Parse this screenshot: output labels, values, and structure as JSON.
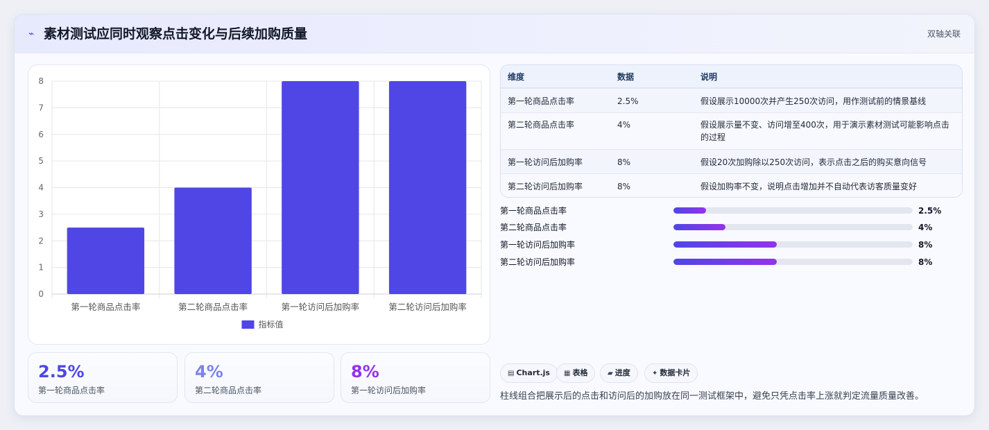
{
  "header": {
    "icon": "lightning-icon",
    "title": "素材测试应同时观察点击变化与后续加购质量",
    "badge": "双轴关联"
  },
  "chart_data": {
    "type": "bar",
    "categories": [
      "第一轮商品点击率",
      "第二轮商品点击率",
      "第一轮访问后加购率",
      "第二轮访问后加购率"
    ],
    "series": [
      {
        "name": "指标值",
        "values": [
          2.5,
          4,
          8,
          8
        ],
        "color": "#4f46e5"
      }
    ],
    "ylim": [
      0,
      8
    ],
    "yticks": [
      0,
      1,
      2,
      3,
      4,
      5,
      6,
      7,
      8
    ],
    "grid": true,
    "legend": "bottom"
  },
  "kpis": [
    {
      "value": "2.5%",
      "label": "第一轮商品点击率",
      "color": "#4f46e5"
    },
    {
      "value": "4%",
      "label": "第二轮商品点击率",
      "color": "#7c83ec"
    },
    {
      "value": "8%",
      "label": "第一轮访问后加购率",
      "color": "#9333ea"
    }
  ],
  "table": {
    "headers": [
      "维度",
      "数据",
      "说明"
    ],
    "rows": [
      {
        "dim": "第一轮商品点击率",
        "value": "2.5%",
        "desc": "假设展示10000次并产生250次访问，用作测试前的情景基线"
      },
      {
        "dim": "第二轮商品点击率",
        "value": "4%",
        "desc": "假设展示量不变、访问增至400次，用于演示素材测试可能影响点击的过程"
      },
      {
        "dim": "第一轮访问后加购率",
        "value": "8%",
        "desc": "假设20次加购除以250次访问，表示点击之后的购买意向信号"
      },
      {
        "dim": "第二轮访问后加购率",
        "value": "8%",
        "desc": "假设加购率不变，说明点击增加并不自动代表访客质量变好"
      }
    ]
  },
  "progress": [
    {
      "label": "第一轮商品点击率",
      "value_text": "2.5%",
      "fraction": 0.025
    },
    {
      "label": "第二轮商品点击率",
      "value_text": "4%",
      "fraction": 0.04
    },
    {
      "label": "第一轮访问后加购率",
      "value_text": "8%",
      "fraction": 0.08
    },
    {
      "label": "第二轮访问后加购率",
      "value_text": "8%",
      "fraction": 0.08
    }
  ],
  "progress_scale_max": 0.185,
  "chips": [
    {
      "icon": "chart-icon",
      "glyph": "▤",
      "label": "Chart.js"
    },
    {
      "icon": "table-icon",
      "glyph": "▦",
      "label": "表格"
    },
    {
      "icon": "progress-icon",
      "glyph": "▰",
      "label": "进度"
    },
    {
      "icon": "sparkle-icon",
      "glyph": "✦",
      "label": "数据卡片"
    }
  ],
  "footnote": "柱线组合把展示后的点击和访问后的加购放在同一测试框架中，避免只凭点击率上涨就判定流量质量改善。"
}
